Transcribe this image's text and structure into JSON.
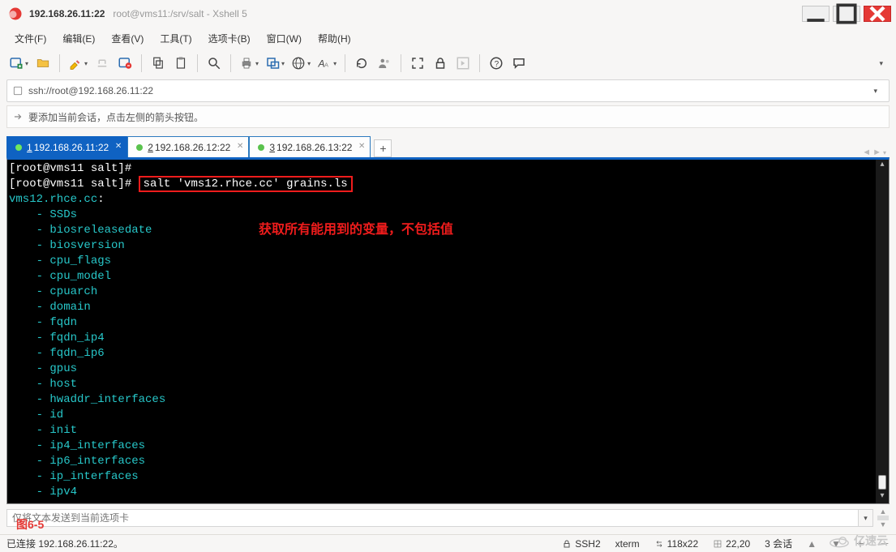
{
  "title": {
    "host": "192.168.26.11:22",
    "path": "root@vms11:/srv/salt - Xshell 5"
  },
  "menu": {
    "file": "文件(F)",
    "edit": "编辑(E)",
    "view": "查看(V)",
    "tools": "工具(T)",
    "tabs": "选项卡(B)",
    "window": "窗口(W)",
    "help": "帮助(H)"
  },
  "address": {
    "url": "ssh://root@192.168.26.11:22"
  },
  "tip": {
    "text": "要添加当前会话，点击左侧的箭头按钮。"
  },
  "tabs": [
    {
      "num": "1",
      "label": "192.168.26.11:22"
    },
    {
      "num": "2",
      "label": "192.168.26.12:22"
    },
    {
      "num": "3",
      "label": "192.168.26.13:22"
    }
  ],
  "terminal": {
    "p1": "[root@vms11 salt]# ",
    "p2": "[root@vms11 salt]# ",
    "cmd": "salt 'vms12.rhce.cc' grains.ls",
    "resp_host": "vms12.rhce.cc",
    "colon": ":",
    "dash": "    - ",
    "items": [
      "SSDs",
      "biosreleasedate",
      "biosversion",
      "cpu_flags",
      "cpu_model",
      "cpuarch",
      "domain",
      "fqdn",
      "fqdn_ip4",
      "fqdn_ip6",
      "gpus",
      "host",
      "hwaddr_interfaces",
      "id",
      "init",
      "ip4_interfaces",
      "ip6_interfaces",
      "ip_interfaces",
      "ipv4"
    ],
    "annotation": "获取所有能用到的变量，不包括值"
  },
  "sendbar": {
    "placeholder": "仅将文本发送到当前选项卡"
  },
  "figure_label": "图6-5",
  "status": {
    "connected": "已连接 192.168.26.11:22。",
    "proto": "SSH2",
    "term": "xterm",
    "size": "118x22",
    "cursor": "22,20",
    "sessions": "3 会话"
  },
  "watermark": "亿速云"
}
